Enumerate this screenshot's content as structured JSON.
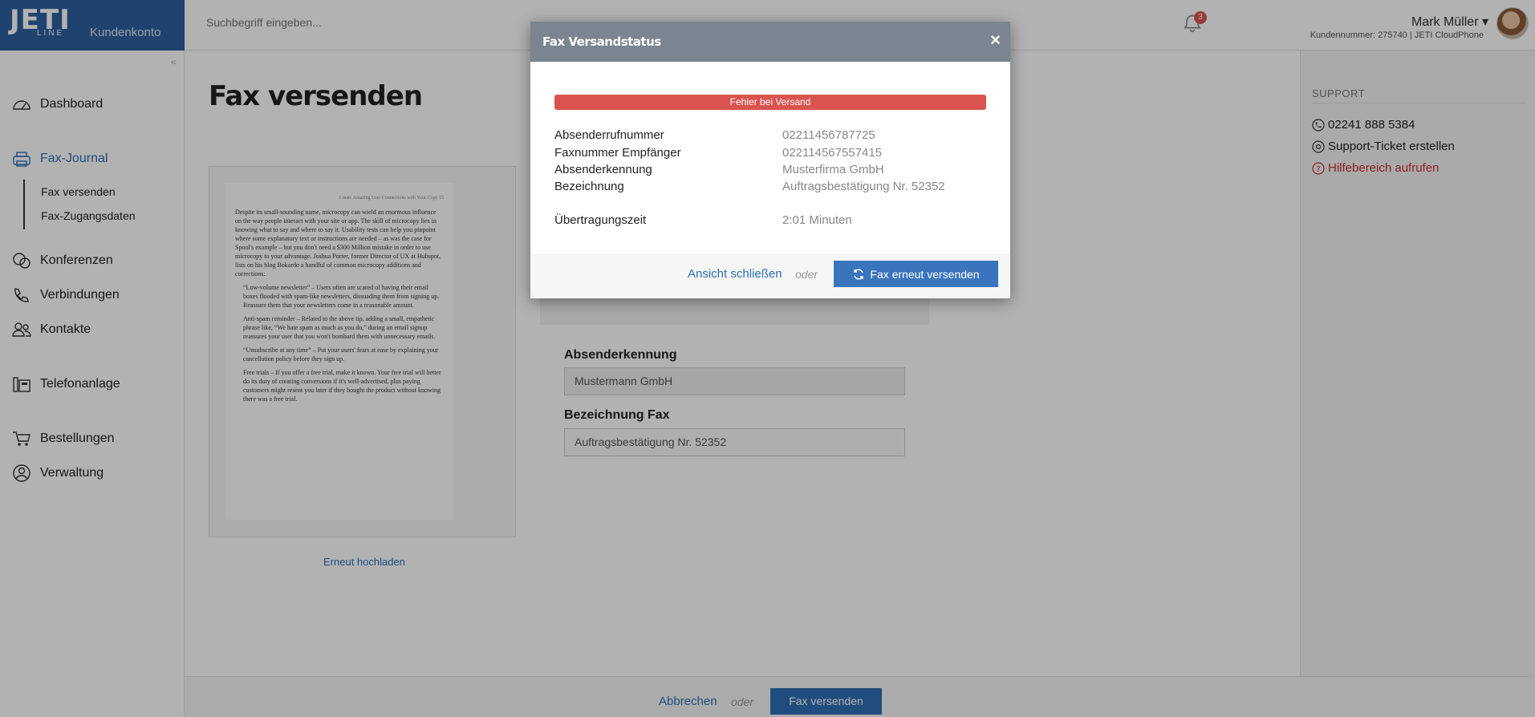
{
  "header": {
    "logo_main": "JETI",
    "logo_sub": "LINE",
    "logo_konto": "Kundenkonto",
    "search_placeholder": "Suchbegriff eingeben...",
    "notification_count": "3",
    "user_name": "Mark Müller ▾",
    "user_sub": "Kundennummer: 275740 | JETI CloudPhone"
  },
  "sidebar": {
    "collapse": "«",
    "items": [
      {
        "label": "Dashboard",
        "icon": "dashboard-icon"
      },
      {
        "label": "Fax-Journal",
        "icon": "fax-icon"
      },
      {
        "label": "Konferenzen",
        "icon": "conference-icon"
      },
      {
        "label": "Verbindungen",
        "icon": "phone-icon"
      },
      {
        "label": "Kontakte",
        "icon": "contacts-icon"
      },
      {
        "label": "Telefonanlage",
        "icon": "phone-system-icon"
      },
      {
        "label": "Bestellungen",
        "icon": "cart-icon"
      },
      {
        "label": "Verwaltung",
        "icon": "user-icon"
      }
    ],
    "subitems": [
      "Fax versenden",
      "Fax-Zugangsdaten"
    ]
  },
  "main": {
    "title": "Fax versenden",
    "reupload": "Erneut hochladen",
    "preview": {
      "header": "Create Amazing User Connections with Your Copy   15",
      "paragraph": "Despite its small-sounding name, microcopy can wield an enormous influence on the way people interact with your site or app. The skill of microcopy lies in knowing what to say and where to say it. Usability tests can help you pinpoint where some explanatory text or instructions are needed – as was the case for Spool's example – but you don't need a $300 Million mistake in order to use microcopy to your advantage. Joshua Porter, former Director of UX at Hubspot, lists on his blog Bokardo a handful of common microcopy additions and corrections:",
      "bullets": [
        "“Low-volume newsletter” – Users often are scared of having their email boxes flooded with spam-like newsletters, dissuading them from signing up. Reassure them that your newsletters come in a reasonable amount.",
        "Anti-spam reminder – Related to the above tip, adding a small, empathetic phrase like, “We hate spam as much as you do,” during an email signup reassures your user that you won't bombard them with unnecessary emails.",
        "“Unsubscribe at any time” – Put your users' fears at ease by explaining your cancellation policy before they sign up.",
        "Free trials – If you offer a free trial, make it known. Your free trial will better do its duty of creating conversions if it's well-advertised, plus paying customers might resent you later if they bought the product without knowing there was a free trial."
      ]
    },
    "form": {
      "absender_label": "Absenderkennung",
      "absender_value": "Mustermann GmbH",
      "bezeichnung_label": "Bezeichnung Fax",
      "bezeichnung_value": "Auftragsbestätigung Nr. 52352"
    }
  },
  "support": {
    "title": "SUPPORT",
    "phone": "02241 888 5384",
    "ticket": "Support-Ticket erstellen",
    "help": "Hilfebereich aufrufen"
  },
  "footer": {
    "cancel": "Abbrechen",
    "oder": "oder",
    "send": "Fax versenden"
  },
  "modal": {
    "title": "Fax Versandstatus",
    "close": "×",
    "status": "Fehler bei Versand",
    "status_color": "#d9534f",
    "rows": [
      {
        "label": "Absenderrufnummer",
        "value": "02211456787725"
      },
      {
        "label": "Faxnummer Empfänger",
        "value": "022114567557415"
      },
      {
        "label": "Absenderkennung",
        "value": "Musterfirma GmbH"
      },
      {
        "label": "Bezeichnung",
        "value": "Auftragsbestätigung Nr. 52352"
      },
      {
        "label": "Übertragungszeit",
        "value": "2:01 Minuten"
      }
    ],
    "close_link": "Ansicht schließen",
    "oder": "oder",
    "resend": "Fax erneut versenden"
  },
  "colors": {
    "brand": "#2e5f9e",
    "accent": "#2e6fb5",
    "danger": "#d9534f"
  }
}
